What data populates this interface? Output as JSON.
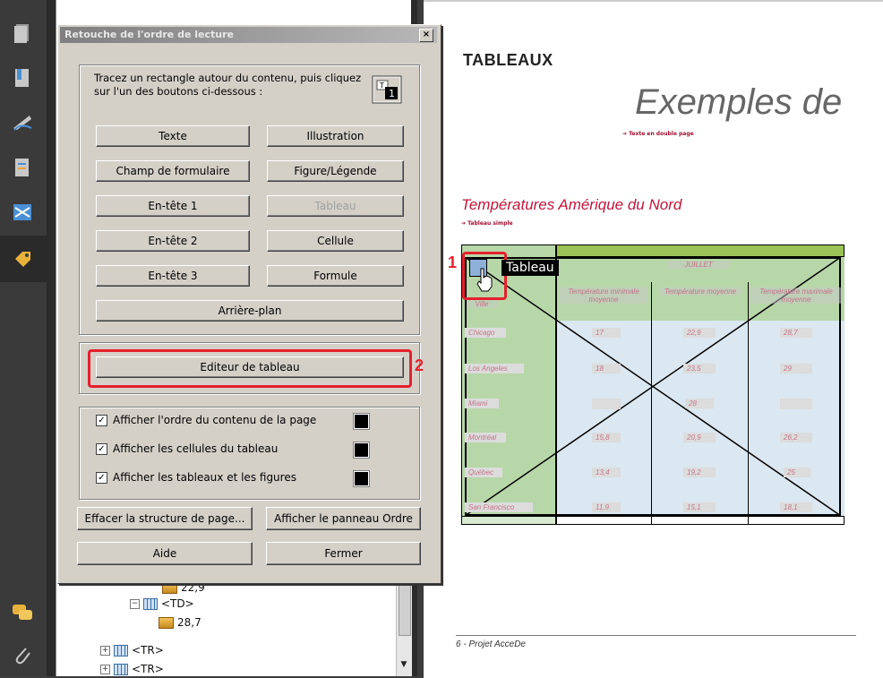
{
  "rail": {
    "icons": [
      "pages-icon",
      "bookmarks-icon",
      "signatures-icon",
      "attachments-pane-icon",
      "content-icon",
      "tags-icon",
      "comments-icon",
      "attachment-clip-icon"
    ]
  },
  "tree": {
    "rows": [
      {
        "label": "22,9"
      },
      {
        "label": "<TD>"
      },
      {
        "label": "28,7"
      },
      {
        "label": "<TR>"
      },
      {
        "label": "<TR>"
      }
    ]
  },
  "dialog": {
    "title": "Retouche de l'ordre de lecture",
    "close": "×",
    "instructions": "Tracez un rectangle autour du contenu, puis cliquez sur l'un des boutons ci-dessous :",
    "buttons": {
      "texte": "Texte",
      "illustration": "Illustration",
      "champ": "Champ de formulaire",
      "figure": "Figure/Légende",
      "entete1": "En-tête 1",
      "tableau": "Tableau",
      "entete2": "En-tête 2",
      "cellule": "Cellule",
      "entete3": "En-tête 3",
      "formule": "Formule",
      "arriere": "Arrière-plan",
      "editeur": "Editeur de tableau",
      "effacer": "Effacer la structure de page...",
      "afficher_panneau": "Afficher le panneau Ordre",
      "aide": "Aide",
      "fermer": "Fermer"
    },
    "checkboxes": [
      {
        "label": "Afficher l'ordre du contenu de la page",
        "checked": true
      },
      {
        "label": "Afficher les cellules du tableau",
        "checked": true
      },
      {
        "label": "Afficher les tableaux et les figures",
        "checked": true
      }
    ],
    "check_mark": "✓"
  },
  "annotations": {
    "marker1": "1",
    "marker2": "2",
    "tooltip": "Tableau",
    "highlight_color": "#e5202c"
  },
  "document": {
    "heading": "TABLEAUX",
    "title": "Exemples de",
    "link1": "➔ Texte en double page",
    "section": "Températures Amérique du Nord",
    "link2": "➔ Tableau simple",
    "footer": "6 - Projet AcceDe",
    "table": {
      "corner": "Ville",
      "group_header": "JUILLET",
      "col_headers": [
        "Température minimale moyenne",
        "Température moyenne",
        "Température maximale moyenne"
      ],
      "rows": [
        {
          "city": "Chicago",
          "values": [
            "17",
            "22,9",
            "28,7"
          ]
        },
        {
          "city": "Los Angeles",
          "values": [
            "18",
            "23,5",
            "29"
          ]
        },
        {
          "city": "Miami",
          "values": [
            "",
            "28",
            ""
          ]
        },
        {
          "city": "Montréal",
          "values": [
            "15,8",
            "20,9",
            "26,2"
          ]
        },
        {
          "city": "Québec",
          "values": [
            "13,4",
            "19,2",
            "25"
          ]
        },
        {
          "city": "San Francisco",
          "values": [
            "11,9",
            "15,1",
            "18,1"
          ]
        }
      ]
    }
  }
}
